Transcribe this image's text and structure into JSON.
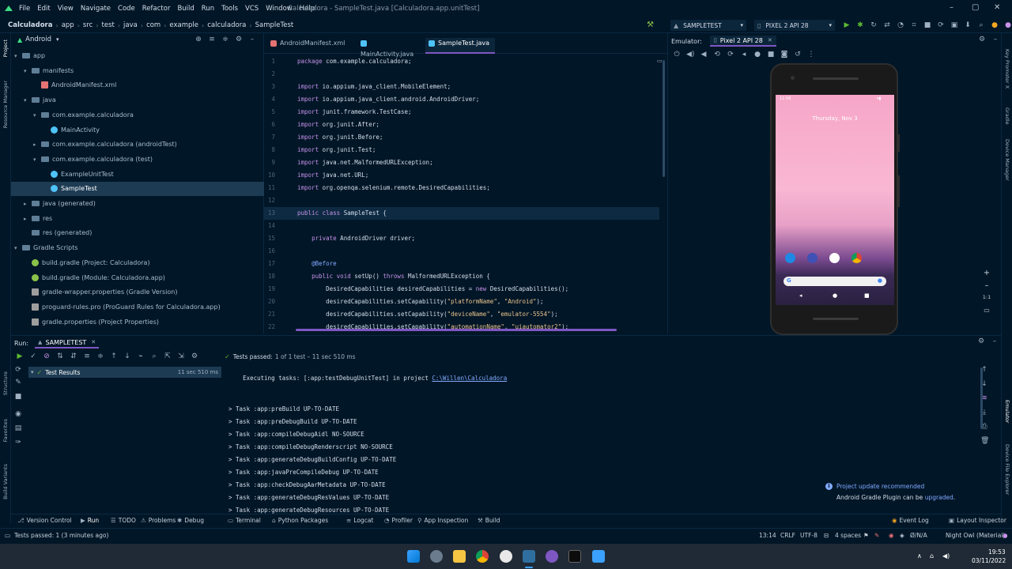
{
  "titlebar": {
    "menu": [
      "File",
      "Edit",
      "View",
      "Navigate",
      "Code",
      "Refactor",
      "Build",
      "Run",
      "Tools",
      "VCS",
      "Window",
      "Help"
    ],
    "window_title": "Calculadora - SampleTest.java [Calculadora.app.unitTest]"
  },
  "navbar": {
    "breadcrumb": [
      "Calculadora",
      "app",
      "src",
      "test",
      "java",
      "com",
      "example",
      "calculadora",
      "SampleTest"
    ],
    "run_config": "SAMPLETEST",
    "device": "PIXEL 2 API 28"
  },
  "left_strip": {
    "project": "Project",
    "resource_manager": "Resource Manager",
    "structure": "Structure",
    "favorites": "Favorites",
    "build_variants": "Build Variants"
  },
  "right_strip": {
    "key_promoter": "Key Promoter X",
    "gradle": "Gradle",
    "device_manager": "Device Manager",
    "emulator": "Emulator",
    "device_file_explorer": "Device File Explorer"
  },
  "project": {
    "view_selector": "Android",
    "items": [
      {
        "label": "app",
        "indent": 0,
        "type": "folder",
        "arrow": "▾"
      },
      {
        "label": "manifests",
        "indent": 1,
        "type": "folder",
        "arrow": "▾"
      },
      {
        "label": "AndroidManifest.xml",
        "indent": 2,
        "type": "xml",
        "arrow": ""
      },
      {
        "label": "java",
        "indent": 1,
        "type": "folder",
        "arrow": "▾"
      },
      {
        "label": "com.example.calculadora",
        "indent": 2,
        "type": "folder",
        "arrow": "▾"
      },
      {
        "label": "MainActivity",
        "indent": 3,
        "type": "class",
        "arrow": ""
      },
      {
        "label": "com.example.calculadora (androidTest)",
        "indent": 2,
        "type": "folder",
        "arrow": "▸"
      },
      {
        "label": "com.example.calculadora (test)",
        "indent": 2,
        "type": "folder",
        "arrow": "▾"
      },
      {
        "label": "ExampleUnitTest",
        "indent": 3,
        "type": "class",
        "arrow": ""
      },
      {
        "label": "SampleTest",
        "indent": 3,
        "type": "class",
        "arrow": "",
        "selected": true
      },
      {
        "label": "java (generated)",
        "indent": 1,
        "type": "folder",
        "arrow": "▸"
      },
      {
        "label": "res",
        "indent": 1,
        "type": "folder",
        "arrow": "▸"
      },
      {
        "label": "res (generated)",
        "indent": 1,
        "type": "folder",
        "arrow": ""
      },
      {
        "label": "Gradle Scripts",
        "indent": 0,
        "type": "folder",
        "arrow": "▾"
      },
      {
        "label": "build.gradle (Project: Calculadora)",
        "indent": 1,
        "type": "gradle",
        "arrow": ""
      },
      {
        "label": "build.gradle (Module: Calculadora.app)",
        "indent": 1,
        "type": "gradle",
        "arrow": ""
      },
      {
        "label": "gradle-wrapper.properties (Gradle Version)",
        "indent": 1,
        "type": "props",
        "arrow": ""
      },
      {
        "label": "proguard-rules.pro (ProGuard Rules for Calculadora.app)",
        "indent": 1,
        "type": "props",
        "arrow": ""
      },
      {
        "label": "gradle.properties (Project Properties)",
        "indent": 1,
        "type": "props",
        "arrow": ""
      }
    ]
  },
  "editor": {
    "tabs": [
      "AndroidManifest.xml",
      "MainActivity.java",
      "SampleTest.java"
    ],
    "active_tab": 2,
    "lines": [
      {
        "n": "1",
        "t": "package com.example.calculadora;"
      },
      {
        "n": "2",
        "t": ""
      },
      {
        "n": "3",
        "t": "import io.appium.java_client.MobileElement;"
      },
      {
        "n": "4",
        "t": "import io.appium.java_client.android.AndroidDriver;"
      },
      {
        "n": "5",
        "t": "import junit.framework.TestCase;"
      },
      {
        "n": "6",
        "t": "import org.junit.After;"
      },
      {
        "n": "7",
        "t": "import org.junit.Before;"
      },
      {
        "n": "8",
        "t": "import org.junit.Test;"
      },
      {
        "n": "9",
        "t": "import java.net.MalformedURLException;"
      },
      {
        "n": "10",
        "t": "import java.net.URL;"
      },
      {
        "n": "11",
        "t": "import org.openqa.selenium.remote.DesiredCapabilities;"
      },
      {
        "n": "12",
        "t": ""
      },
      {
        "n": "13",
        "t": "public class SampleTest {"
      },
      {
        "n": "14",
        "t": ""
      },
      {
        "n": "15",
        "t": "    private AndroidDriver driver;"
      },
      {
        "n": "16",
        "t": ""
      },
      {
        "n": "17",
        "t": "    @Before"
      },
      {
        "n": "18",
        "t": "    public void setUp() throws MalformedURLException {"
      },
      {
        "n": "19",
        "t": "        DesiredCapabilities desiredCapabilities = new DesiredCapabilities();"
      },
      {
        "n": "20",
        "t": "        desiredCapabilities.setCapability(\"platformName\", \"Android\");"
      },
      {
        "n": "21",
        "t": "        desiredCapabilities.setCapability(\"deviceName\", \"emulator-5554\");"
      },
      {
        "n": "22",
        "t": "        desiredCapabilities.setCapability(\"automationName\", \"uiautomator2\");"
      }
    ]
  },
  "emulator": {
    "label": "Emulator:",
    "device_tab": "Pixel 2 API 28",
    "phone_time": "11:56",
    "phone_date": "Thursday, Nov 3",
    "zoom_label": "1:1"
  },
  "run": {
    "label": "Run:",
    "tab": "SAMPLETEST",
    "status": "Tests passed:",
    "status_detail": "1 of 1 test – 11 sec 510 ms",
    "tree_root": "Test Results",
    "tree_time": "11 sec 510 ms",
    "console_header_prefix": "Executing tasks: [:app:testDebugUnitTest] in project ",
    "console_header_link": "C:\\Willen\\Calculadora",
    "console_lines": [
      "> Task :app:preBuild UP-TO-DATE",
      "> Task :app:preDebugBuild UP-TO-DATE",
      "> Task :app:compileDebugAidl NO-SOURCE",
      "> Task :app:compileDebugRenderscript NO-SOURCE",
      "> Task :app:generateDebugBuildConfig UP-TO-DATE",
      "> Task :app:javaPreCompileDebug UP-TO-DATE",
      "> Task :app:checkDebugAarMetadata UP-TO-DATE",
      "> Task :app:generateDebugResValues UP-TO-DATE",
      "> Task :app:generateDebugResources UP-TO-DATE"
    ]
  },
  "notification": {
    "title": "Project update recommended",
    "body_prefix": "Android Gradle Plugin can be ",
    "link": "upgraded",
    "body_suffix": "."
  },
  "tool_tabs": [
    "Version Control",
    "Run",
    "TODO",
    "Problems",
    "Debug",
    "Terminal",
    "Python Packages",
    "Logcat",
    "Profiler",
    "App Inspection",
    "Build",
    "Event Log",
    "Layout Inspector"
  ],
  "statusbar": {
    "message": "Tests passed: 1 (3 minutes ago)",
    "position": "13:14",
    "line_sep": "CRLF",
    "encoding": "UTF-8",
    "indent": "4 spaces",
    "vcs": "Ø/N/A",
    "theme": "Night Owl (Material)"
  },
  "taskbar": {
    "time": "19:53",
    "date": "03/11/2022"
  },
  "colors": {
    "background": "#011627",
    "accent": "#7e57c2",
    "selection": "#1d3b53",
    "success": "#5fb832"
  }
}
